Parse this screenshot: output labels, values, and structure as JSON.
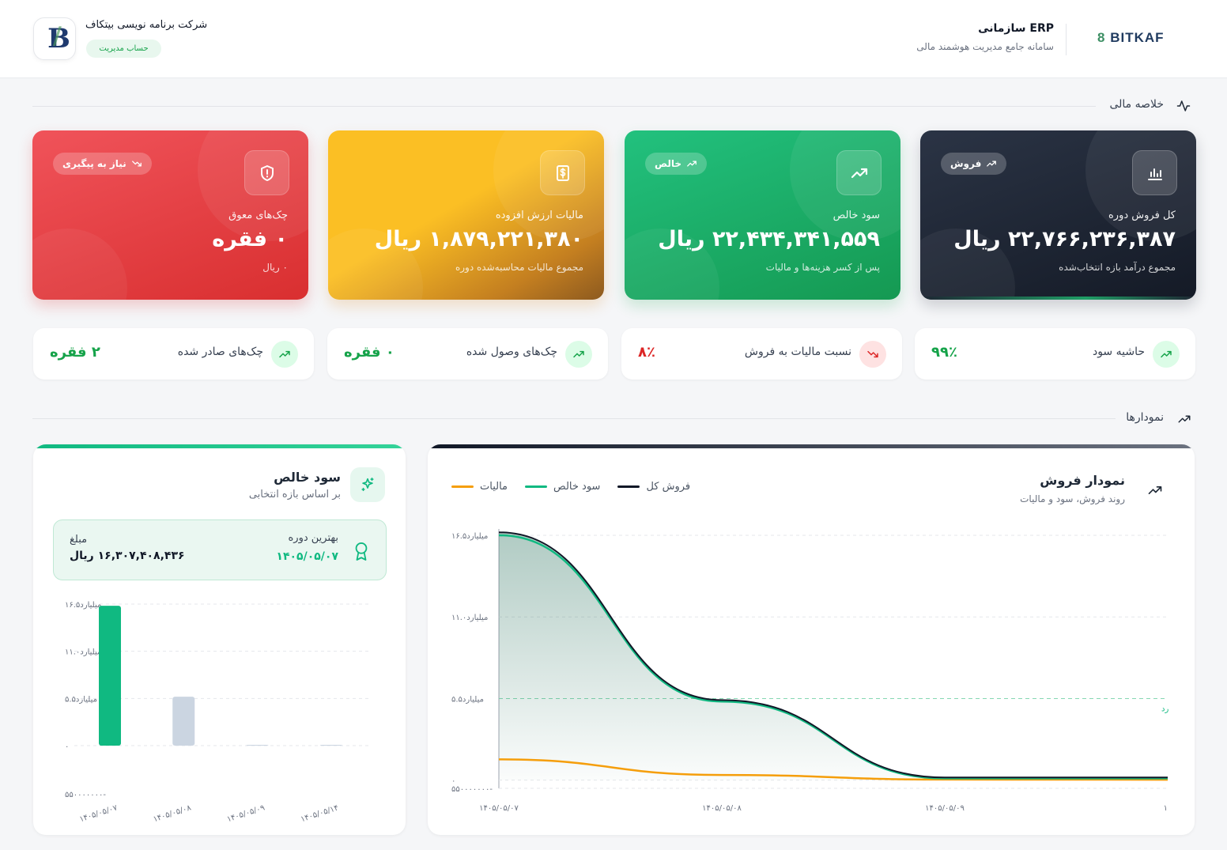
{
  "header": {
    "brand_prefix": "8",
    "brand_name": "BITKAF",
    "app_title": "ERP سازمانی",
    "app_subtitle": "سامانه جامع مدیریت هوشمند مالی",
    "company_logo_letter": "B",
    "company_name": "شرکت برنامه نویسی بیتکاف",
    "role_badge": "حساب مدیریت"
  },
  "sections": {
    "summary_title": "خلاصه مالی",
    "charts_title": "نمودارها"
  },
  "kpis": [
    {
      "id": "sales",
      "chip": "فروش",
      "label": "کل فروش دوره",
      "value": "۲۲,۷۶۶,۲۳۶,۳۸۷ ریال",
      "sub": "مجموع درآمد بازه انتخاب‌شده",
      "icon": "bar-chart-icon"
    },
    {
      "id": "profit",
      "chip": "خالص",
      "label": "سود خالص",
      "value": "۲۲,۴۳۴,۳۴۱,۵۵۹ ریال",
      "sub": "پس از کسر هزینه‌ها و مالیات",
      "icon": "trend-up-icon"
    },
    {
      "id": "vat",
      "chip": "",
      "label": "مالیات ارزش افزوده",
      "value": "۱,۸۷۹,۲۲۱,۳۸۰ ریال",
      "sub": "مجموع مالیات محاسبه‌شده دوره",
      "icon": "dollar-bill-icon"
    },
    {
      "id": "checks",
      "chip": "نیاز به پیگیری",
      "label": "چک‌های معوق",
      "value": "۰ فقره",
      "sub": "۰ ریال",
      "icon": "shield-alert-icon"
    }
  ],
  "stats": [
    {
      "id": "margin",
      "label": "حاشیه سود",
      "value": "۹۹٪",
      "trend": "up",
      "color": "#16a34a"
    },
    {
      "id": "tax_ratio",
      "label": "نسبت مالیات به فروش",
      "value": "۸٪",
      "trend": "down",
      "color": "#dc2626"
    },
    {
      "id": "received_checks",
      "label": "چک‌های وصول شده",
      "value": "۰ فقره",
      "trend": "up",
      "color": "#16a34a"
    },
    {
      "id": "issued_checks",
      "label": "چک‌های صادر شده",
      "value": "۲ فقره",
      "trend": "up",
      "color": "#16a34a"
    }
  ],
  "sales_panel": {
    "title": "نمودار فروش",
    "subtitle": "روند فروش، سود و مالیات",
    "legend": [
      {
        "name": "فروش کل",
        "color": "#111827"
      },
      {
        "name": "سود خالص",
        "color": "#10b981"
      },
      {
        "name": "مالیات",
        "color": "#f59e0b"
      }
    ],
    "ref_label": "رد"
  },
  "profit_panel": {
    "title": "سود خالص",
    "subtitle": "بر اساس بازه انتخابی",
    "best_label": "بهترین دوره",
    "best_value": "۱۴۰۵/۰۵/۰۷",
    "amount_label": "مبلغ",
    "amount_value": "۱۶,۳۰۷,۴۰۸,۴۳۶ ریال"
  },
  "chart_data": [
    {
      "type": "line",
      "title": "نمودار فروش",
      "x": [
        "۱۴۰۵/۰۵/۰۷",
        "۱۴۰۵/۰۵/۰۸",
        "۱۴۰۵/۰۵/۰۹",
        "۱"
      ],
      "y_ticks": [
        "۱۶.۵میلیارد",
        "۱۱.۰میلیارد",
        "۵.۵میلیارد",
        "۰",
        "۵۵۰۰۰۰۰۰۰-"
      ],
      "ylim": [
        -550000000,
        16500000000
      ],
      "reference_line": 5500000000,
      "series": [
        {
          "name": "فروش کل",
          "values": [
            16700000000,
            5400000000,
            180000000,
            180000000
          ]
        },
        {
          "name": "سود خالص",
          "values": [
            16500000000,
            5300000000,
            120000000,
            120000000
          ]
        },
        {
          "name": "مالیات",
          "values": [
            1400000000,
            350000000,
            40000000,
            30000000
          ]
        }
      ],
      "grid": true,
      "legend_position": "top"
    },
    {
      "type": "bar",
      "title": "سود خالص",
      "categories": [
        "۱۴۰۵/۰۵/۰۷",
        "۱۴۰۵/۰۵/۰۸",
        "۱۴۰۵/۰۵/۰۹",
        "۱۴۰۵/۰۵/۱۴"
      ],
      "values": [
        16307408436,
        5700000000,
        0,
        0
      ],
      "y_ticks": [
        "۱۶.۵میلیارد",
        "۱۱.۰میلیارد",
        "۵.۵میلیارد",
        "۰",
        "۵۵۰۰۰۰۰۰۰-"
      ],
      "ylim": [
        -5500000000,
        16500000000
      ],
      "highlight_color": "#10b981",
      "muted_color": "#cbd5e1",
      "grid": true
    }
  ]
}
